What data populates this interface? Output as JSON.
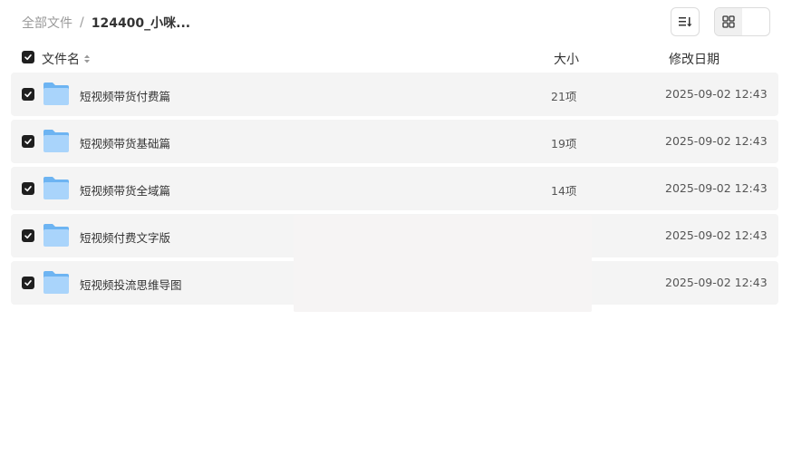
{
  "breadcrumb": {
    "root": "全部文件",
    "separator": "/",
    "current": "124400_小咪..."
  },
  "toolbar": {
    "sort_icon": "sort-lines-icon",
    "list_view_icon": "list-view-icon",
    "grid_view_icon": "grid-view-icon"
  },
  "table": {
    "columns": {
      "name": "文件名",
      "size": "大小",
      "date": "修改日期"
    },
    "rows": [
      {
        "name": "短视频带货付费篇",
        "size": "21项",
        "date": "2025-09-02 12:43"
      },
      {
        "name": "短视频带货基础篇",
        "size": "19项",
        "date": "2025-09-02 12:43"
      },
      {
        "name": "短视频带货全域篇",
        "size": "14项",
        "date": "2025-09-02 12:43"
      },
      {
        "name": "短视频付费文字版",
        "size": "",
        "date": "2025-09-02 12:43"
      },
      {
        "name": "短视频投流思维导图",
        "size": "",
        "date": "2025-09-02 12:43"
      }
    ]
  },
  "colors": {
    "row_bg": "#f4f4f4",
    "folder_light": "#a9d4fb",
    "folder_dark": "#6db4f2",
    "checkbox": "#1f1f1f"
  }
}
